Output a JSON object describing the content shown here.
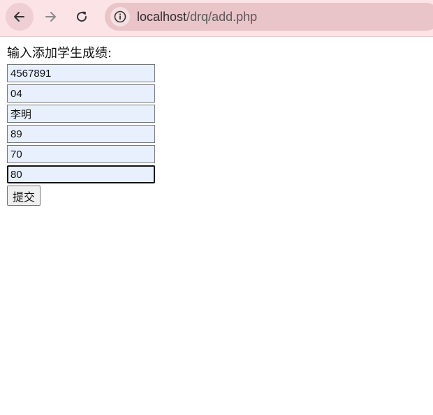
{
  "browser": {
    "url_host": "localhost",
    "url_path": "/drq/add.php"
  },
  "form": {
    "title": "输入添加学生成绩:",
    "fields": [
      {
        "value": "4567891"
      },
      {
        "value": "04"
      },
      {
        "value": "李明"
      },
      {
        "value": "89"
      },
      {
        "value": "70"
      },
      {
        "value": "80",
        "focused": true
      }
    ],
    "submit_label": "提交"
  },
  "colors": {
    "toolbar_bg": "#fbe3e6",
    "omnibox_bg": "#e9c4c9",
    "field_bg": "#e8f0fe"
  },
  "icons": [
    "back-arrow-icon",
    "forward-arrow-icon",
    "reload-icon",
    "site-info-icon"
  ]
}
